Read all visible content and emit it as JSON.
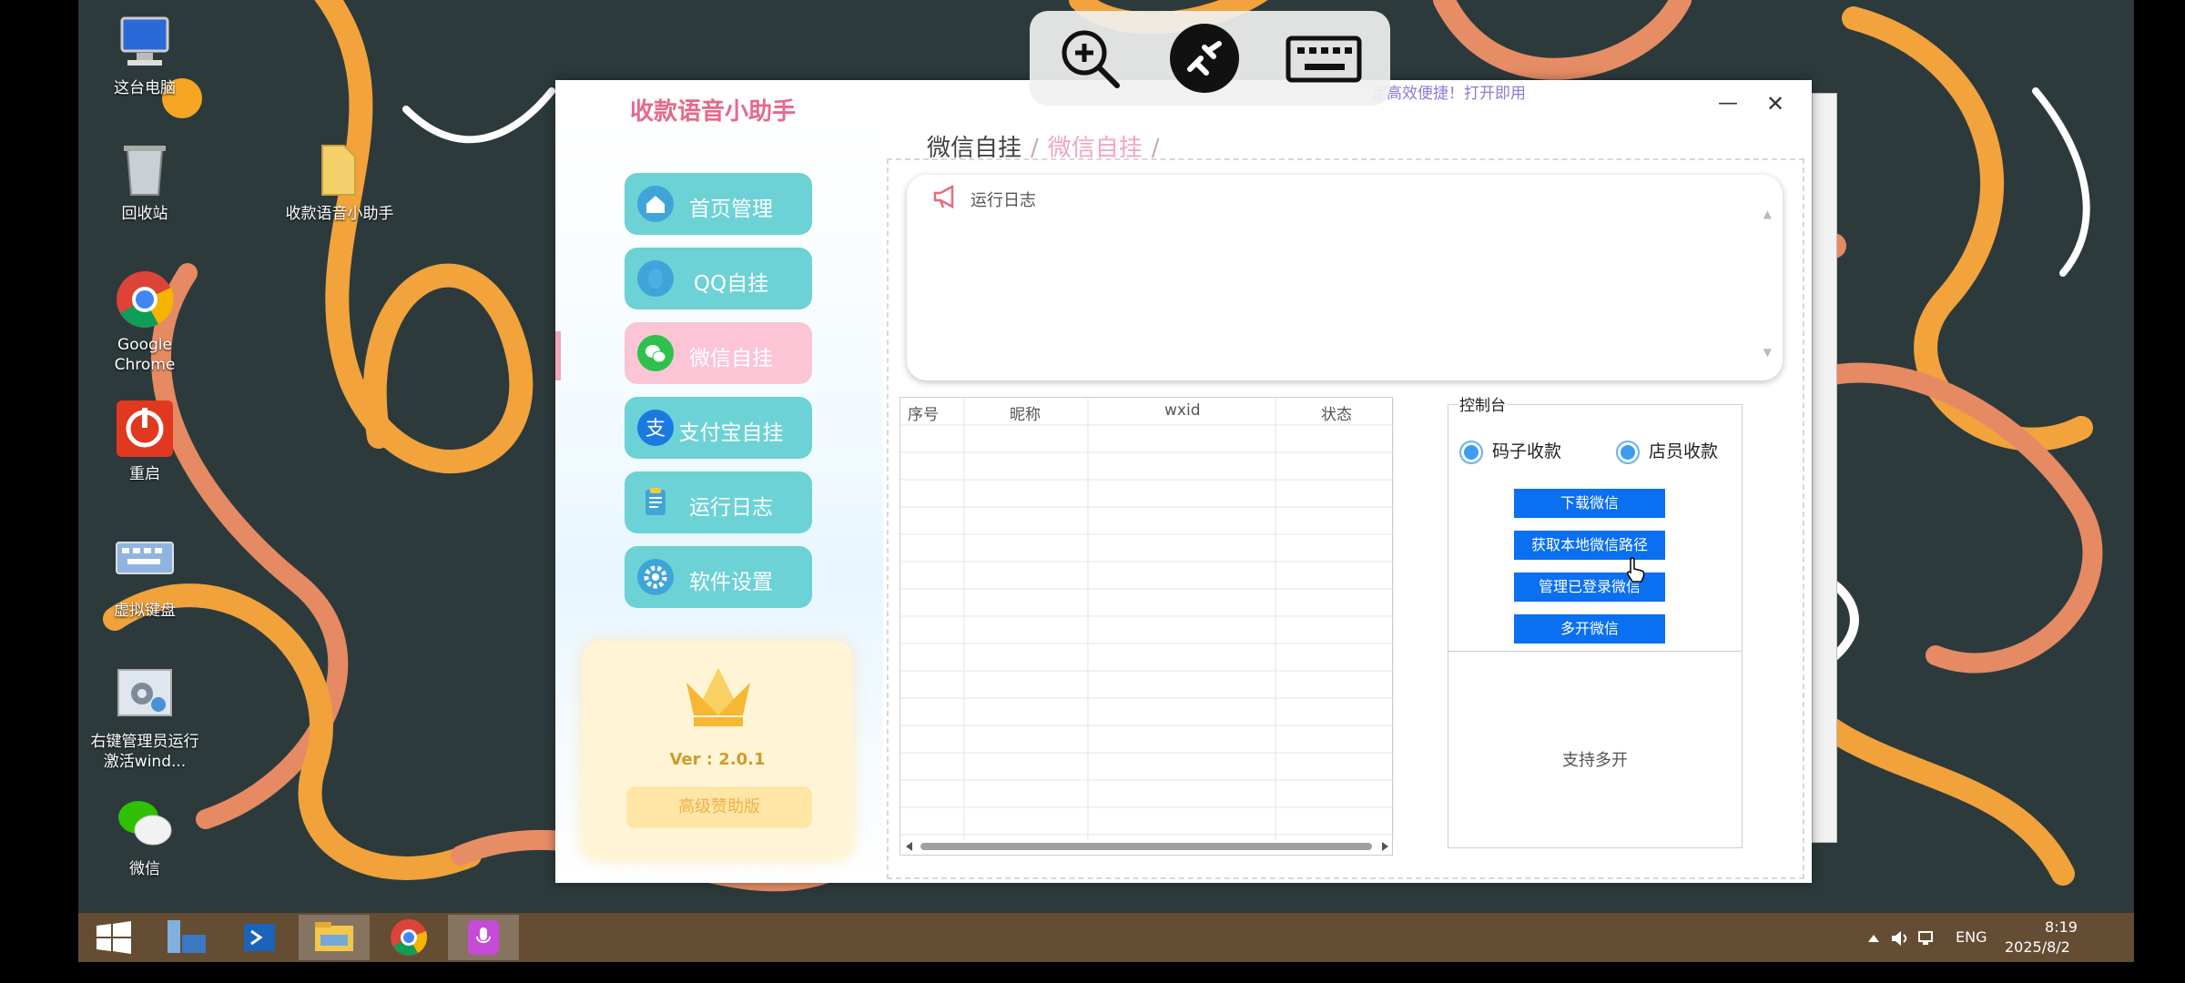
{
  "desktop": {
    "icons": [
      {
        "label": "这台电脑"
      },
      {
        "label": "回收站"
      },
      {
        "label": "收款语音小助手"
      },
      {
        "label": "Google Chrome"
      },
      {
        "label": "重启"
      },
      {
        "label": "虚拟键盘"
      },
      {
        "label": "右键管理员运行激活wind..."
      },
      {
        "label": "微信"
      }
    ]
  },
  "remote_toolbar": {
    "items": [
      "zoom-in-icon",
      "remote-connect-icon",
      "keyboard-icon"
    ]
  },
  "app": {
    "title": "收款语音小助手",
    "notice": "定高效便捷！打开即用",
    "breadcrumb": {
      "parent": "微信自挂",
      "current": "微信自挂",
      "separator": "/"
    },
    "nav": [
      {
        "label": "首页管理",
        "icon": "home-icon",
        "active": false
      },
      {
        "label": "QQ自挂",
        "icon": "qq-icon",
        "active": false
      },
      {
        "label": "微信自挂",
        "icon": "wechat-icon",
        "active": true
      },
      {
        "label": "支付宝自挂",
        "icon": "alipay-icon",
        "active": false
      },
      {
        "label": "运行日志",
        "icon": "clipboard-icon",
        "active": false
      },
      {
        "label": "软件设置",
        "icon": "gear-icon",
        "active": false
      }
    ],
    "vip": {
      "version": "Ver : 2.0.1",
      "button": "高级赞助版"
    },
    "log": {
      "title": "运行日志"
    },
    "table": {
      "columns": [
        "序号",
        "昵称",
        "wxid",
        "状态"
      ],
      "rows": []
    },
    "console": {
      "title": "控制台",
      "radios": [
        {
          "label": "码子收款",
          "checked": true
        },
        {
          "label": "店员收款",
          "checked": true
        }
      ],
      "buttons": [
        "下载微信",
        "获取本地微信路径",
        "管理已登录微信",
        "多开微信"
      ],
      "multi_text": "支持多开"
    },
    "colors": {
      "title": "#e46a8c",
      "nav": "#6cd2d6",
      "nav_active": "#fbc5d6",
      "button": "#0a6ff0"
    }
  },
  "taskbar": {
    "apps": [
      "windows-start-icon",
      "server-manager-icon",
      "powershell-icon",
      "file-explorer-icon",
      "chrome-icon",
      "podcast-app-icon"
    ],
    "lang": "ENG",
    "time": "8:19",
    "date": "2025/8/2"
  }
}
